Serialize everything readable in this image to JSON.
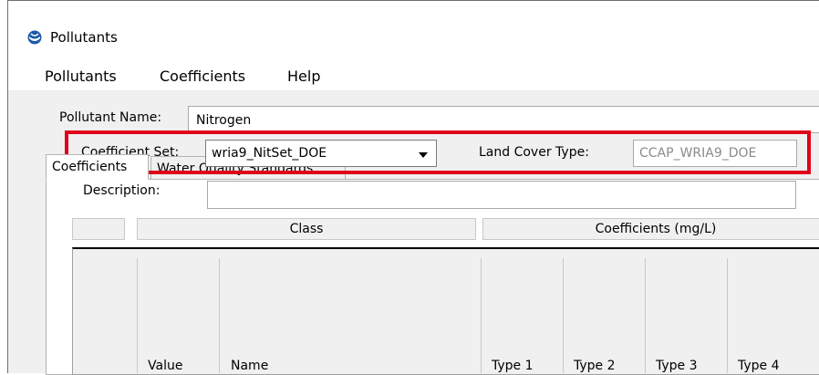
{
  "window": {
    "title": "Pollutants",
    "icon": "noaa-logo-icon"
  },
  "menu": [
    "Pollutants",
    "Coefficients",
    "Help"
  ],
  "pollutant": {
    "label": "Pollutant Name:",
    "value": "Nitrogen"
  },
  "tabs": [
    {
      "label": "Coefficients",
      "active": true
    },
    {
      "label": "Water Quality Standards",
      "active": false
    }
  ],
  "coefficient_set": {
    "label": "Coefficient Set:",
    "value": "wria9_NitSet_DOE"
  },
  "land_cover": {
    "label": "Land Cover Type:",
    "value": "CCAP_WRIA9_DOE"
  },
  "description": {
    "label": "Description:",
    "value": ""
  },
  "table": {
    "group_headers": [
      "Class",
      "Coefficients (mg/L)"
    ],
    "columns": [
      "Value",
      "Name",
      "Type 1",
      "Type 2",
      "Type 3",
      "Type 4"
    ]
  },
  "colors": {
    "highlight": "#e0001a"
  }
}
